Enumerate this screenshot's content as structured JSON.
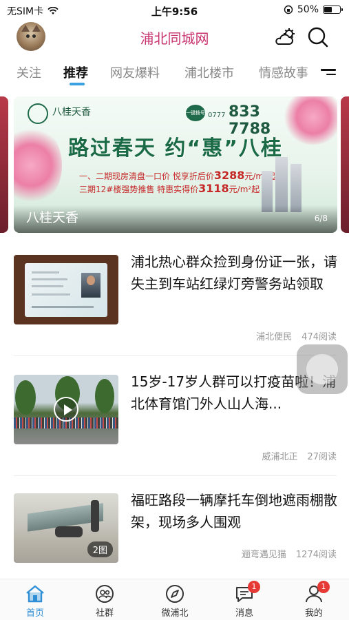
{
  "status_bar": {
    "carrier": "无SIM卡",
    "time": "上午9:56",
    "battery_percent": "50%",
    "battery_level": 0.5
  },
  "header": {
    "title": "浦北同城网",
    "avatar_icon": "cat-avatar",
    "weather_icon": "weather-icon",
    "search_icon": "search-icon"
  },
  "tabs": [
    {
      "label": "关注",
      "active": false
    },
    {
      "label": "推荐",
      "active": true
    },
    {
      "label": "网友爆料",
      "active": false
    },
    {
      "label": "浦北楼市",
      "active": false
    },
    {
      "label": "情感故事",
      "active": false
    }
  ],
  "banner": {
    "brand": "八桂天香",
    "phone_prefix": "一键拨号",
    "area_code": "0777",
    "phone": "833 7788",
    "headline": "路过春天 约“惠”八桂",
    "offer1_prefix": "一、二期现房清盘一口价 悦享折后价",
    "offer1_price": "3288",
    "offer1_unit": "元/m²起",
    "offer2_prefix": "三期12#楼强势推售 特惠实得价",
    "offer2_price": "3118",
    "offer2_unit": "元/m²起",
    "caption": "八桂天香",
    "pager": "6/8"
  },
  "articles": [
    {
      "title": "浦北热心群众捡到身份证一张，请失主到车站红绿灯旁警务站领取",
      "source": "浦北便民",
      "reads": "474阅读"
    },
    {
      "title": "15岁-17岁人群可以打疫苗啦！浦北体育馆门外人山人海...",
      "source": "威浦北正",
      "reads": "27阅读"
    },
    {
      "title": "福旺路段一辆摩托车倒地遮雨棚散架，现场多人围观",
      "source": "逦弯遇见猫",
      "reads": "1274阅读",
      "photo_count": "2图"
    }
  ],
  "tabbar": [
    {
      "label": "首页",
      "icon": "home-icon",
      "active": true,
      "badge": ""
    },
    {
      "label": "社群",
      "icon": "community-icon",
      "active": false,
      "badge": ""
    },
    {
      "label": "微浦北",
      "icon": "compass-icon",
      "active": false,
      "badge": ""
    },
    {
      "label": "消息",
      "icon": "message-icon",
      "active": false,
      "badge": "1"
    },
    {
      "label": "我的",
      "icon": "profile-icon",
      "active": false,
      "badge": "1"
    }
  ],
  "colors": {
    "brand": "#c8326e",
    "accent": "#3aa2e0",
    "active_tab": "#2f8fd6",
    "badge": "#e53935"
  }
}
